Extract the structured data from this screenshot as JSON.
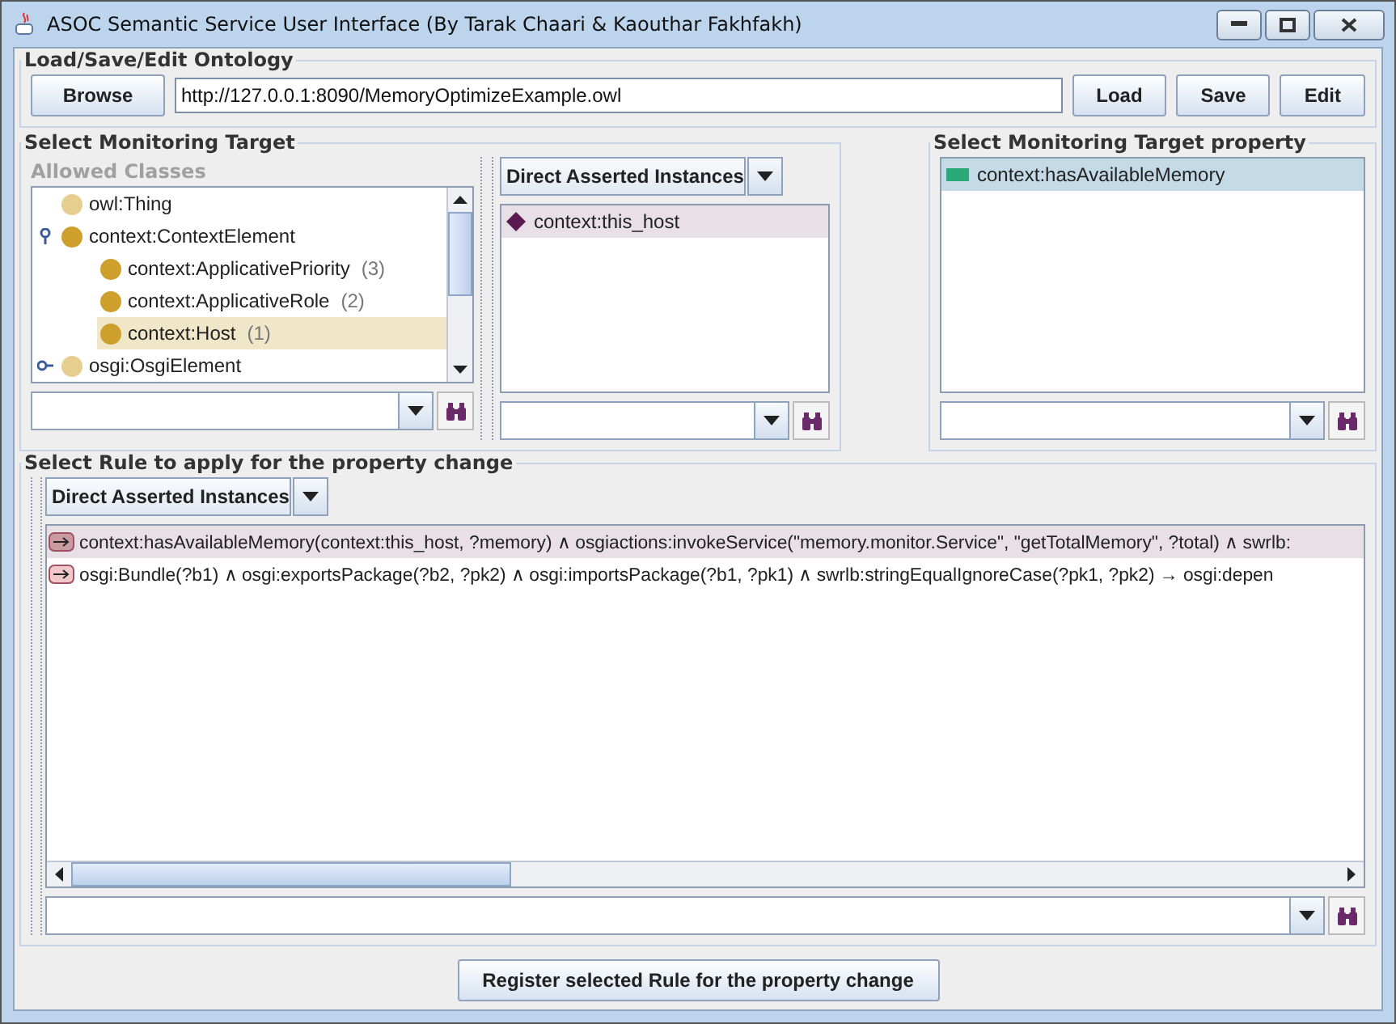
{
  "window": {
    "title": "ASOC Semantic Service User Interface (By Tarak Chaari & Kaouthar Fakhfakh)"
  },
  "ontology": {
    "title": "Load/Save/Edit Ontology",
    "browse": "Browse",
    "url": "http://127.0.0.1:8090/MemoryOptimizeExample.owl",
    "buttons": [
      "Load",
      "Save",
      "Edit"
    ]
  },
  "target": {
    "title": "Select Monitoring Target",
    "classes_label": "Allowed Classes",
    "tree": [
      {
        "label": "owl:Thing",
        "color": "#e6cf8e",
        "selected": false
      },
      {
        "label": "context:ContextElement",
        "color": "#cda02e",
        "selected": false,
        "expanded": true,
        "children": [
          {
            "label": "context:ApplicativePriority",
            "count": "(3)",
            "color": "#cda02e",
            "selected": false
          },
          {
            "label": "context:ApplicativeRole",
            "count": "(2)",
            "color": "#cda02e",
            "selected": false
          },
          {
            "label": "context:Host",
            "count": "(1)",
            "color": "#cda02e",
            "selected": true
          }
        ]
      },
      {
        "label": "osgi:OsgiElement",
        "color": "#e6cf8e",
        "selected": false,
        "expanded": false
      }
    ],
    "instances_mode": "Direct Asserted Instances",
    "instances": [
      {
        "label": "context:this_host",
        "selected": true
      }
    ]
  },
  "property": {
    "title": "Select Monitoring Target property",
    "items": [
      {
        "label": "context:hasAvailableMemory",
        "selected": true
      }
    ]
  },
  "rules": {
    "title": "Select Rule to apply for the property change",
    "mode": "Direct Asserted Instances",
    "items": [
      {
        "text": "context:hasAvailableMemory(context:this_host, ?memory) ∧ osgiactions:invokeService(\"memory.monitor.Service\", \"getTotalMemory\", ?total) ∧ swrlb:",
        "selected": true
      },
      {
        "text": "osgi:Bundle(?b1) ∧ osgi:exportsPackage(?b2, ?pk2) ∧ osgi:importsPackage(?b1, ?pk1) ∧ swrlb:stringEqualIgnoreCase(?pk1, ?pk2) → osgi:depen",
        "selected": false
      }
    ]
  },
  "register_button": "Register selected Rule for the property change"
}
